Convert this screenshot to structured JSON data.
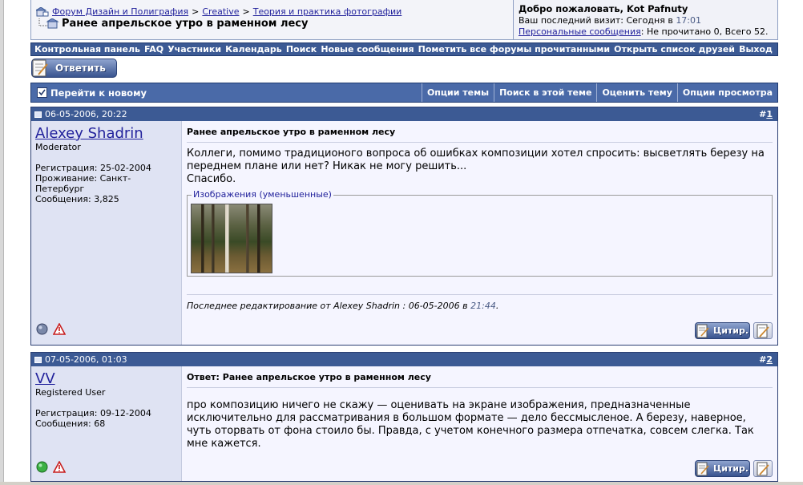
{
  "breadcrumb": {
    "items": [
      "Форум Дизайн и Полиграфия",
      "Creative",
      "Теория и практика фотографии"
    ],
    "separator": ">",
    "thread_title": "Ранее апрельское утро в раменном лесу"
  },
  "welcome": {
    "greeting": "Добро пожаловать, Kot Pafnuty",
    "last_visit_label": "Ваш последний визит: Сегодня в",
    "last_visit_time": "17:01",
    "pm_link": "Персональные сообщения",
    "pm_status": ": Не прочитано 0, Всего 52."
  },
  "top_menu": [
    "Контрольная панель",
    "FAQ",
    "Участники",
    "Календарь",
    "Поиск",
    "Новые сообщения",
    "Пометить все форумы прочитанными",
    "Открыть список друзей",
    "Выход"
  ],
  "reply_button": "Ответить",
  "thread_tools": {
    "goto_new": "Перейти к новому",
    "options": [
      "Опции темы",
      "Поиск в этой теме",
      "Оценить тему",
      "Опции просмотра"
    ]
  },
  "posts": [
    {
      "date": "06-05-2006, 20:22",
      "number_prefix": "#",
      "number": "1",
      "username": "Alexey Shadrin",
      "user_title": "Moderator",
      "info": [
        "Регистрация: 25-02-2004",
        "Проживание: Санкт-Петербург",
        "Сообщения: 3,825"
      ],
      "title": "Ранее апрельское утро в раменном лесу",
      "text_lines": [
        "Коллеги, помимо традиционого вопроса об ошибках композиции хотел спросить: высветлять березу на",
        "переднем плане или нет? Никак не могу решить...",
        "Спасибо."
      ],
      "attachments_legend": "Изображения (уменьшенные)",
      "edited_prefix": "Последнее редактирование от Alexey Shadrin : 06-05-2006 в",
      "edited_time": "21:44",
      "edited_suffix": ".",
      "status": "offline",
      "quote_label": "Цитир."
    },
    {
      "date": "07-05-2006, 01:03",
      "number_prefix": "#",
      "number": "2",
      "username": "VV",
      "user_title": "Registered User",
      "info": [
        "Регистрация: 09-12-2004",
        "Сообщения: 68"
      ],
      "title": "Ответ: Ранее апрельское утро в раменном лесу",
      "text_lines": [
        "про композицию ничего не скажу — оценивать на экране изображения, предназначенные",
        "исключительно для рассматривания в большом формате — дело бессмысленое. А березу, наверное,",
        "чуть оторвать от фона стоило бы. Правда, с учетом конечного размера отпечатка, совсем слегка. Так",
        "мне кажется."
      ],
      "status": "online",
      "quote_label": "Цитир."
    }
  ],
  "colors": {
    "bar_blue": "#3c5a94",
    "link": "#22229c",
    "user_col": "#dfe3f3",
    "online": "#3cb043",
    "offline": "#7a88a8"
  }
}
